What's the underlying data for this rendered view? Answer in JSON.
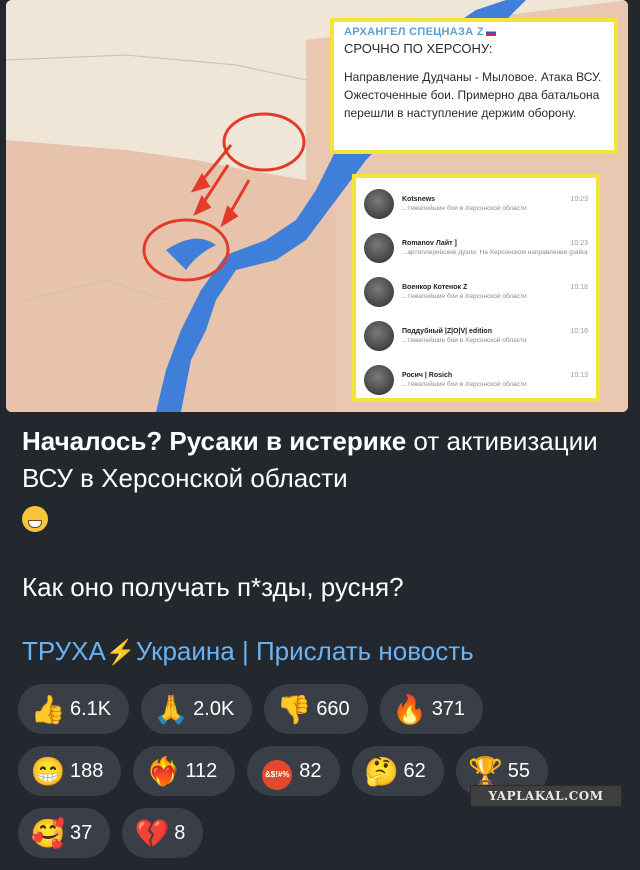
{
  "map": {
    "callout": {
      "channel": "АРХАНГЕЛ СПЕЦНАЗА Z",
      "headline": "СРОЧНО ПО ХЕРСОНУ:",
      "text": "Направление Дудчаны - Мыловое. Атака ВСУ. Ожесточенные бои. Примерно два батальона перешли в наступление держим оборону."
    },
    "feed": [
      {
        "name": "Kotsnews",
        "time": "10:23",
        "text": "...тяжелейшие бои в Херсонской области"
      },
      {
        "name": "Romanov Лайт ]",
        "time": "10:23",
        "text": "...артиллерийские дуэли. На Херсонском направлении (район плацдарма ВСУ у р. И..."
      },
      {
        "name": "Военкор Котенок Z",
        "time": "10:18",
        "text": "...тяжелейшие бои в Херсонской области"
      },
      {
        "name": "Поддубный |Z|O|V| edition",
        "time": "10:16",
        "text": "...тяжелейшие бои в Херсонской области"
      },
      {
        "name": "Росич | Rosich",
        "time": "10:13",
        "text": "...тяжелейшие бои в Херсонской области"
      }
    ]
  },
  "message": {
    "title_bold": "Началось? Русаки в истерике",
    "title_rest": " от активизации ВСУ в Херсонской области",
    "line2": "Как оно получать п*зды, русня?",
    "link1_part1": "ТРУХА",
    "link1_bolt": "⚡",
    "link1_part2": "Украина",
    "separator": "|",
    "link2": "Прислать новость"
  },
  "reactions": [
    {
      "icon": "👍",
      "count": "6.1K"
    },
    {
      "icon": "🙏",
      "count": "2.0K"
    },
    {
      "icon": "👎",
      "count": "660"
    },
    {
      "icon": "🔥",
      "count": "371"
    },
    {
      "icon": "😁",
      "count": "188"
    },
    {
      "icon": "❤️‍🔥",
      "count": "112"
    },
    {
      "icon": "&$!#%",
      "count": "82"
    },
    {
      "icon": "🤔",
      "count": "62"
    },
    {
      "icon": "🏆",
      "count": "55"
    },
    {
      "icon": "🥰",
      "count": "37"
    },
    {
      "icon": "💔",
      "count": "8"
    }
  ],
  "watermark": "YAPLAKAL.COM",
  "colors": {
    "background": "#23282f",
    "link": "#6ab2f2",
    "reaction_bg": "#3a3f47",
    "highlight": "#f3e43a",
    "river": "#3f7fd9"
  }
}
